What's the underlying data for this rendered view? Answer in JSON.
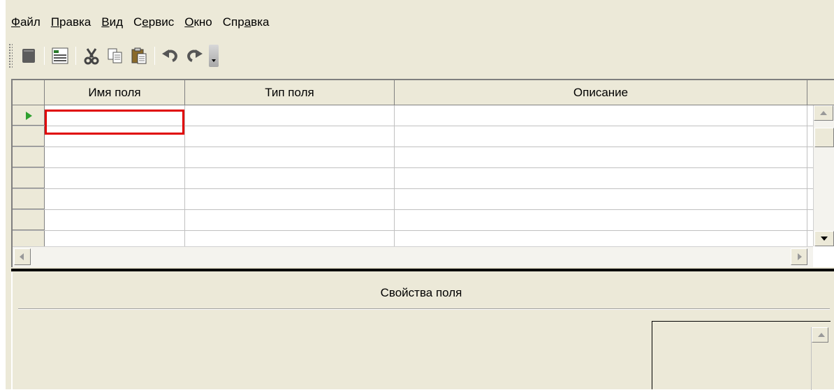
{
  "menu": [
    {
      "pre": "",
      "accel": "Ф",
      "post": "айл"
    },
    {
      "pre": "",
      "accel": "П",
      "post": "равка"
    },
    {
      "pre": "",
      "accel": "В",
      "post": "ид"
    },
    {
      "pre": "С",
      "accel": "е",
      "post": "рвис"
    },
    {
      "pre": "",
      "accel": "О",
      "post": "кно"
    },
    {
      "pre": "Спр",
      "accel": "а",
      "post": "вка"
    }
  ],
  "toolbar": {
    "icons": [
      "view-icon",
      "properties-icon",
      "cut-icon",
      "copy-icon",
      "paste-icon",
      "undo-icon",
      "redo-icon"
    ]
  },
  "grid": {
    "columns": [
      "Имя поля",
      "Тип поля",
      "Описание"
    ],
    "row_count": 7,
    "current_row_marker": "row-1"
  },
  "properties": {
    "title": "Свойства поля"
  },
  "colors": {
    "highlight": "#e00000",
    "current_row_arrow": "#2fa02f",
    "window_bg": "#ece9d8"
  }
}
